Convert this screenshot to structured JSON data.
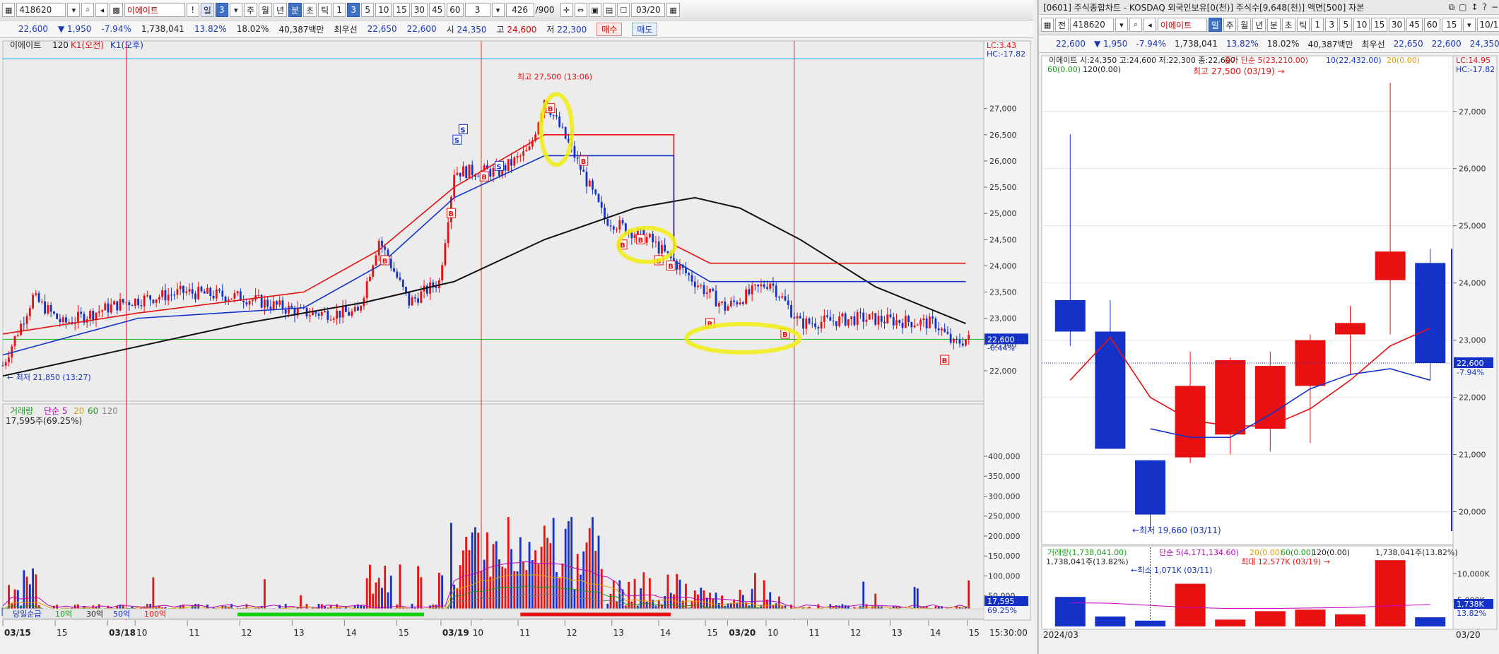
{
  "left": {
    "toolbar": {
      "code": "418620",
      "name": "이에이트",
      "buttons": [
        "!",
        "일",
        "3",
        "주",
        "월",
        "년",
        "분",
        "초",
        "틱",
        "1",
        "3",
        "5",
        "10",
        "15",
        "30",
        "45",
        "60"
      ],
      "interval": "3",
      "count": "426",
      "total": "/900",
      "date": "03/20"
    },
    "quote": {
      "price": "22,600",
      "change": "1,950",
      "pct": "-7.94%",
      "volume": "1,738,041",
      "turnover": "13.82%",
      "ratio": "18.02%",
      "amount": "40,387백만",
      "best_label": "최우선",
      "ask": "22,650",
      "bid": "22,600",
      "open_label": "시",
      "open": "24,350",
      "high_label": "고",
      "high": "24,600",
      "low_label": "저",
      "low": "22,300",
      "buy": "매수",
      "sell": "매도"
    },
    "price_legend": {
      "name": "이에이트",
      "period": "120",
      "k1": "K1(오전)",
      "k2": "K1(오후)"
    },
    "lc": "LC:3.43",
    "hc": "HC:-17.82",
    "max_label": "최고 27,500 (13:06)",
    "min_label": "최저 21,850 (13:27)",
    "cur_price": "22,600",
    "cur_pct": "-0.44%",
    "vol_legend": {
      "name": "거래량",
      "ma": "단순",
      "p1": "5",
      "p2": "20",
      "p3": "60",
      "p4": "120",
      "value": "17,595주(69.25%)"
    },
    "vol_cur": "17,595",
    "vol_pct": "69.25%",
    "bottom_legend": [
      "당일순급",
      "10억",
      "30억",
      "50억",
      "100억"
    ],
    "time_end": "15:30:00"
  },
  "right": {
    "title": "[0601] 주식종합차트 - KOSDAQ 외국인보유[0(천)] 주식수[9,648(천)] 액면[500] 자본",
    "toolbar": {
      "prefix": "전",
      "code": "418620",
      "name": "이에이트",
      "buttons": [
        "일",
        "주",
        "월",
        "년",
        "분",
        "초",
        "틱",
        "1",
        "3",
        "5",
        "10",
        "15",
        "30",
        "45",
        "60"
      ],
      "interval": "15",
      "count": "10/1"
    },
    "quote": {
      "price": "22,600",
      "change": "1,950",
      "pct": "-7.94%",
      "volume": "1,738,041",
      "turnover": "13.82%",
      "ratio": "18.02%",
      "amount": "40,387백만",
      "best_label": "최우선",
      "ask": "22,650",
      "bid": "22,600",
      "open": "24,350",
      "close": "22"
    },
    "price_legend": "이에이트 시:24,350 고:24,600 저:22,300 종:22,600",
    "ma_legend_a": "종가 단순 5(23,210.00)",
    "ma_legend_b": "10(22,432.00)",
    "ma_legend_c": "20(0.00)",
    "ma_legend_d": "60(0.00)",
    "ma_legend_e": "120(0.00)",
    "lc": "LC:14.95",
    "hc": "HC:-17.82",
    "max_label": "최고 27,500 (03/19)",
    "min_label": "최저 19,660 (03/11)",
    "cur_price": "22,600",
    "cur_pct": "-7.94%",
    "vol_legend": "거래량(1,738,041.00)",
    "vol_ma": "단순 5(4,171,134.60)",
    "vol_ma2": "20(0.00)",
    "vol_ma3": "60(0.00)",
    "vol_ma4": "120(0.00)",
    "vol_right": "1,738,041주(13.82%)",
    "vol_sub": "1,738,041주(13.82%)",
    "vol_max": "최대 12,577K (03/19)",
    "vol_min": "최소 1,071K (03/11)",
    "vol_cur": "1,738K",
    "vol_cur_pct": "13.82%",
    "x_start": "2024/03",
    "x_end": "03/20"
  },
  "chart_data": [
    {
      "type": "candlestick",
      "title": "이에이트 3분봉",
      "ylim": [
        21500,
        28100
      ],
      "y_ticks": [
        22000,
        22500,
        23000,
        23500,
        24000,
        24500,
        25000,
        25500,
        26000,
        26500,
        27000
      ],
      "x_ticks": [
        "03/15",
        "15",
        "03/18",
        "10",
        "11",
        "12",
        "13",
        "14",
        "15",
        "03/19",
        "10",
        "11",
        "12",
        "13",
        "14",
        "15",
        "03/20",
        "10",
        "11",
        "12",
        "13",
        "14",
        "15"
      ],
      "day_separators": [
        "03/18",
        "03/19",
        "03/20"
      ],
      "ref_line": 22600,
      "top_ref_line": 27950,
      "key_points": [
        {
          "t": 0,
          "v": 22100
        },
        {
          "t": 10,
          "v": 23400
        },
        {
          "t": 20,
          "v": 22900
        },
        {
          "t": 40,
          "v": 23300
        },
        {
          "t": 60,
          "v": 23500
        },
        {
          "t": 80,
          "v": 23400
        },
        {
          "t": 100,
          "v": 23100
        },
        {
          "t": 118,
          "v": 23100
        },
        {
          "t": 125,
          "v": 24500
        },
        {
          "t": 135,
          "v": 23300
        },
        {
          "t": 145,
          "v": 23700
        },
        {
          "t": 150,
          "v": 25800
        },
        {
          "t": 165,
          "v": 25800
        },
        {
          "t": 175,
          "v": 26200
        },
        {
          "t": 180,
          "v": 27200
        },
        {
          "t": 190,
          "v": 26100
        },
        {
          "t": 200,
          "v": 24900
        },
        {
          "t": 215,
          "v": 24500
        },
        {
          "t": 230,
          "v": 23700
        },
        {
          "t": 240,
          "v": 23200
        },
        {
          "t": 255,
          "v": 23700
        },
        {
          "t": 265,
          "v": 22900
        },
        {
          "t": 285,
          "v": 23000
        },
        {
          "t": 310,
          "v": 22900
        },
        {
          "t": 316,
          "v": 22500
        },
        {
          "t": 320,
          "v": 22600
        }
      ],
      "ma120": [
        {
          "t": 0,
          "v": 21900
        },
        {
          "t": 40,
          "v": 22400
        },
        {
          "t": 80,
          "v": 22900
        },
        {
          "t": 120,
          "v": 23300
        },
        {
          "t": 150,
          "v": 23700
        },
        {
          "t": 180,
          "v": 24500
        },
        {
          "t": 210,
          "v": 25100
        },
        {
          "t": 230,
          "v": 25300
        },
        {
          "t": 245,
          "v": 25100
        },
        {
          "t": 265,
          "v": 24500
        },
        {
          "t": 290,
          "v": 23600
        },
        {
          "t": 320,
          "v": 22900
        }
      ],
      "k1_am": [
        {
          "t": 0,
          "v": 22700
        },
        {
          "t": 45,
          "v": 23100
        },
        {
          "t": 100,
          "v": 23500
        },
        {
          "t": 125,
          "v": 24300
        },
        {
          "t": 150,
          "v": 25500
        },
        {
          "t": 180,
          "v": 26500
        },
        {
          "t": 223,
          "v": 26500
        },
        {
          "t": 223,
          "v": 24400
        },
        {
          "t": 235,
          "v": 24050
        },
        {
          "t": 320,
          "v": 24050
        }
      ],
      "k1_pm": [
        {
          "t": 0,
          "v": 22300
        },
        {
          "t": 45,
          "v": 23000
        },
        {
          "t": 100,
          "v": 23200
        },
        {
          "t": 125,
          "v": 24000
        },
        {
          "t": 150,
          "v": 25300
        },
        {
          "t": 180,
          "v": 26100
        },
        {
          "t": 223,
          "v": 26100
        },
        {
          "t": 223,
          "v": 24100
        },
        {
          "t": 235,
          "v": 23700
        },
        {
          "t": 320,
          "v": 23700
        }
      ],
      "signals": [
        {
          "t": 149,
          "v": 25000,
          "label": "B"
        },
        {
          "t": 127,
          "v": 24100,
          "label": "B"
        },
        {
          "t": 151,
          "v": 26400,
          "label": "S"
        },
        {
          "t": 153,
          "v": 26600,
          "label": "S"
        },
        {
          "t": 160,
          "v": 25700,
          "label": "B"
        },
        {
          "t": 165,
          "v": 25900,
          "label": "S"
        },
        {
          "t": 182,
          "v": 27000,
          "label": "B"
        },
        {
          "t": 193,
          "v": 26000,
          "label": "B"
        },
        {
          "t": 206,
          "v": 24400,
          "label": "B"
        },
        {
          "t": 212,
          "v": 24500,
          "label": "B"
        },
        {
          "t": 218,
          "v": 24100,
          "label": "B"
        },
        {
          "t": 222,
          "v": 24000,
          "label": "B"
        },
        {
          "t": 235,
          "v": 22900,
          "label": "B"
        },
        {
          "t": 260,
          "v": 22700,
          "label": "B"
        },
        {
          "t": 313,
          "v": 22200,
          "label": "B"
        }
      ],
      "volume_ylim": [
        0,
        430000
      ],
      "volume_ticks": [
        50000,
        100000,
        150000,
        200000,
        250000,
        300000,
        350000,
        400000
      ]
    },
    {
      "type": "candlestick",
      "title": "이에이트 일봉",
      "ylim": [
        19500,
        27800
      ],
      "y_ticks": [
        20000,
        21000,
        22000,
        23000,
        24000,
        25000,
        26000,
        27000
      ],
      "candles": [
        {
          "o": 23700,
          "h": 26600,
          "l": 22900,
          "c": 23150,
          "vol": 5.6
        },
        {
          "o": 23150,
          "h": 23700,
          "l": 21200,
          "c": 21100,
          "vol": 1.9
        },
        {
          "o": 20900,
          "h": 20900,
          "l": 19660,
          "c": 19950,
          "vol": 1.1
        },
        {
          "o": 20950,
          "h": 22800,
          "l": 20850,
          "c": 22200,
          "vol": 8.1
        },
        {
          "o": 21350,
          "h": 22700,
          "l": 21000,
          "c": 22650,
          "vol": 1.3
        },
        {
          "o": 21450,
          "h": 22800,
          "l": 21050,
          "c": 22550,
          "vol": 2.9
        },
        {
          "o": 22200,
          "h": 23100,
          "l": 21200,
          "c": 23000,
          "vol": 3.2
        },
        {
          "o": 23100,
          "h": 23600,
          "l": 22400,
          "c": 23300,
          "vol": 2.3
        },
        {
          "o": 24050,
          "h": 27500,
          "l": 23100,
          "c": 24550,
          "vol": 12.577
        },
        {
          "o": 24350,
          "h": 24600,
          "l": 22300,
          "c": 22600,
          "vol": 1.738
        }
      ],
      "ma5": [
        22300,
        23050,
        22000,
        21600,
        21500,
        21500,
        21800,
        22300,
        22900,
        23210
      ],
      "ma10": [
        null,
        null,
        21450,
        21300,
        21300,
        21700,
        22150,
        22400,
        22500,
        22300
      ],
      "volume_ylim": [
        0,
        13000
      ],
      "volume_ticks": [
        5000,
        10000
      ]
    }
  ]
}
